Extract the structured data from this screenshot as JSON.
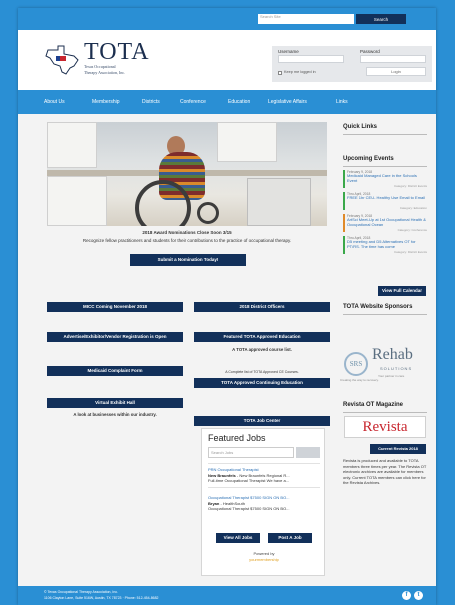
{
  "colors": {
    "brand_blue": "#2a8fd4",
    "navy": "#12305a",
    "event_green": "#3aa84a",
    "event_orange": "#e08a2a"
  },
  "topbar": {
    "search_placeholder": "Search Site",
    "search_button": "Search"
  },
  "header": {
    "logo_title": "TOTA",
    "logo_sub_1": "Texas Occupational",
    "logo_sub_2": "Therapy Association, Inc.",
    "login": {
      "username_label": "Username",
      "password_label": "Password",
      "remember_label": "Keep me logged in",
      "login_button": "Login"
    }
  },
  "nav": {
    "items": [
      "About Us",
      "Membership",
      "Districts",
      "Conference",
      "Education",
      "Legislative Affairs",
      "Links"
    ]
  },
  "hero": {
    "caption_title": "2018 Award Nominations Close Soon 3/15",
    "caption_text": "Recognize fellow practitioners and students for their contributions to the practice of occupational therapy.",
    "cta_button": "Submit a Nomination Today!"
  },
  "main_buttons": {
    "left": [
      "MICC Coming November 2018",
      "Advertise/Exhibitor/Vendor Registration is Open",
      "Medicaid Complaint Form",
      "Virtual Exhibit Hall"
    ],
    "left_note": "A look at businesses within our industry.",
    "right": [
      "2018 District Officers",
      "Featured TOTA Approved Education",
      "TOTA Approved Continuing Education",
      "TOTA Job Center"
    ],
    "right_note_1": "A TOTA approved course list.",
    "right_note_2": "A Complete list of TOTA Approved CE Courses."
  },
  "jobs": {
    "title": "Featured Jobs",
    "search_placeholder": "Search Jobs",
    "items": [
      {
        "title": "PRN Occupational Therapist",
        "employer": "New Braunfels",
        "location": "- New Braunfels Regional R...",
        "desc": "Full-time Occupational Therapist We have a..."
      },
      {
        "title": "Occupational Therapist $7500 SIGN ON BO...",
        "employer": "Bryan",
        "location": "- HealthSouth",
        "desc": "Occupational Therapist $7500 SIGN ON BO..."
      }
    ],
    "view_all_button": "View All Jobs",
    "post_button": "Post A Job",
    "powered_by": "Powered by",
    "powered_brand": "yourmembership"
  },
  "sidebar": {
    "quick_links_title": "Quick Links",
    "upcoming_title": "Upcoming Events",
    "events": [
      {
        "date": "February 9, 2018",
        "name": "Medicaid Managed Care in the Schools Event",
        "category": "Category: District Events",
        "color": "#3aa84a"
      },
      {
        "date": "Thru April, 2018",
        "name": "FREE 1hr CEU- Healthy Use Email to Email",
        "category": "Category: Education",
        "color": "#3aa84a"
      },
      {
        "date": "February 9, 2018",
        "name": "ArtSci Meet-Up at 1st Occupational Health & Occupational Ocean",
        "category": "Category: Conference",
        "color": "#e08a2a"
      },
      {
        "date": "Thru April, 2018",
        "name": "D5 meeting and D5 Alternatives OT for PT/RS. The time has come",
        "category": "Category: District Events",
        "color": "#3aa84a"
      }
    ],
    "full_calendar_button": "View Full Calendar",
    "sponsors_title": "TOTA Website Sponsors",
    "sponsor_srs": "SRS",
    "sponsor_srs_tagline": "Creating the way to recovery.",
    "sponsor_rehab": "Rehab",
    "sponsor_rehab_sub": "SOLUTIONS",
    "sponsor_rehab_tagline": "Your partner in care",
    "revista_title": "Revista OT Magazine",
    "revista_logo": "Revista",
    "revista_button": "Current Revista 2018",
    "revista_text": "Revista is produced and available to TOTA members three times per year. The Revista OT electronic archives are available for members only. Current TOTA members can click here for the Revista Archives."
  },
  "footer": {
    "line_1": "© Texas Occupational Therapy Association, Inc.",
    "line_2": "1106 Clayton Lane, Suite 516W, Austin, TX 78723 · Phone: 512-454-8682"
  }
}
